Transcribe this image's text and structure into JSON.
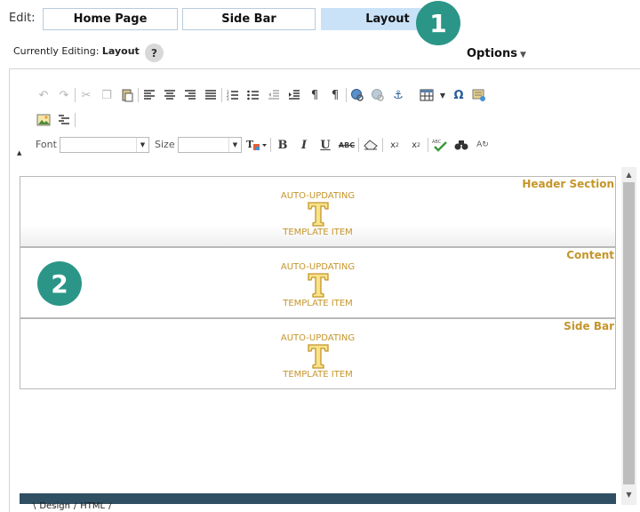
{
  "edit_label": "Edit:",
  "tabs": [
    {
      "label": "Home Page",
      "active": false
    },
    {
      "label": "Side Bar",
      "active": false
    },
    {
      "label": "Layout",
      "active": true
    }
  ],
  "callouts": {
    "one": "1",
    "two": "2"
  },
  "currently_editing": {
    "prefix": "Currently Editing:",
    "value": "Layout",
    "help": "?"
  },
  "options_label": "Options",
  "toolbar": {
    "font_label": "Font",
    "size_label": "Size",
    "font_value": "",
    "size_value": ""
  },
  "sections": [
    {
      "title": "Header Section",
      "line1": "AUTO-UPDATING",
      "line2": "TEMPLATE ITEM"
    },
    {
      "title": "Content",
      "line1": "AUTO-UPDATING",
      "line2": "TEMPLATE ITEM"
    },
    {
      "title": "Side Bar",
      "line1": "AUTO-UPDATING",
      "line2": "TEMPLATE ITEM"
    }
  ],
  "mode_tabs": [
    "Design",
    "HTML"
  ],
  "colors": {
    "accent_teal": "#2b9688",
    "active_tab": "#c9e2f8",
    "template_gold": "#c5952a",
    "bottom_bar": "#2f4f63"
  }
}
